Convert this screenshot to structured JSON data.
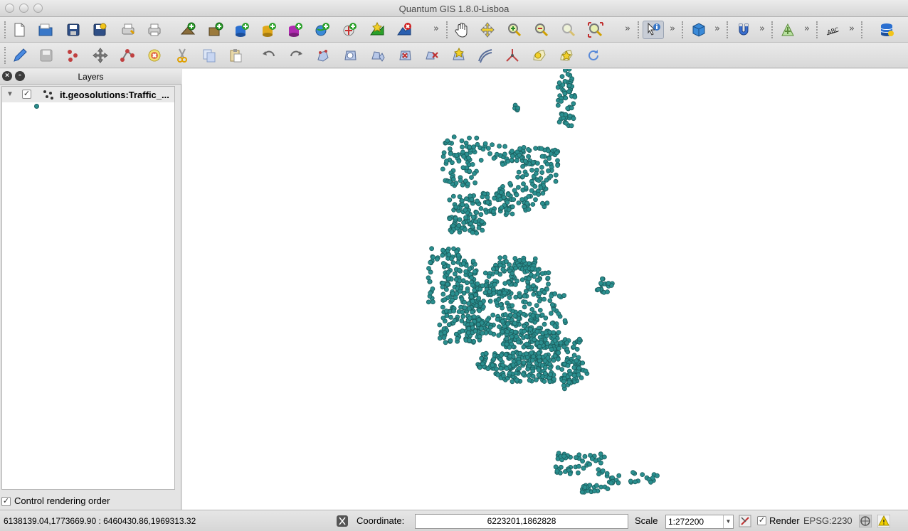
{
  "window": {
    "title": "Quantum GIS 1.8.0-Lisboa"
  },
  "toolbar1": {
    "buttons": [
      "new-project",
      "open-project",
      "save-project",
      "save-as",
      "print-composer",
      "print",
      "add-vector-layer",
      "add-raster-layer",
      "add-postgis-layer",
      "add-spatialite-layer",
      "add-mssql-layer",
      "add-wms-layer",
      "add-wfs-layer",
      "new-shapefile",
      "remove-layer",
      "pan",
      "pan-to-selection",
      "zoom-in",
      "zoom-out",
      "zoom-actual",
      "zoom-full",
      "identify",
      "3d-box",
      "magnet",
      "processing",
      "label",
      "database"
    ],
    "overflow": "»"
  },
  "toolbar2": {
    "buttons": [
      "toggle-edit",
      "save-edits",
      "add-feature",
      "move-feature",
      "node-tool",
      "delete-selected",
      "cut-features",
      "copy-features",
      "paste-features",
      "undo",
      "redo",
      "simplify",
      "add-ring",
      "add-part",
      "delete-ring",
      "delete-part",
      "reshape",
      "offset-curve",
      "split-features",
      "merge-features",
      "merge-attributes",
      "rotate-point"
    ]
  },
  "layers_panel": {
    "title": "Layers",
    "layer_name": "it.geosolutions:Traffic_...",
    "layer_visible": true,
    "control_rendering_order_label": "Control rendering order",
    "control_rendering_order_checked": true
  },
  "map": {
    "point_color": "#2a8f8f",
    "point_stroke": "#1b5d5d"
  },
  "status": {
    "extents": "6138139.04,1773669.90 : 6460430.86,1969313.32",
    "coordinate_label": "Coordinate:",
    "coordinate_value": "6223201,1862828",
    "scale_label": "Scale",
    "scale_value": "1:272200",
    "render_label": "Render",
    "render_checked": true,
    "crs": "EPSG:2230"
  }
}
